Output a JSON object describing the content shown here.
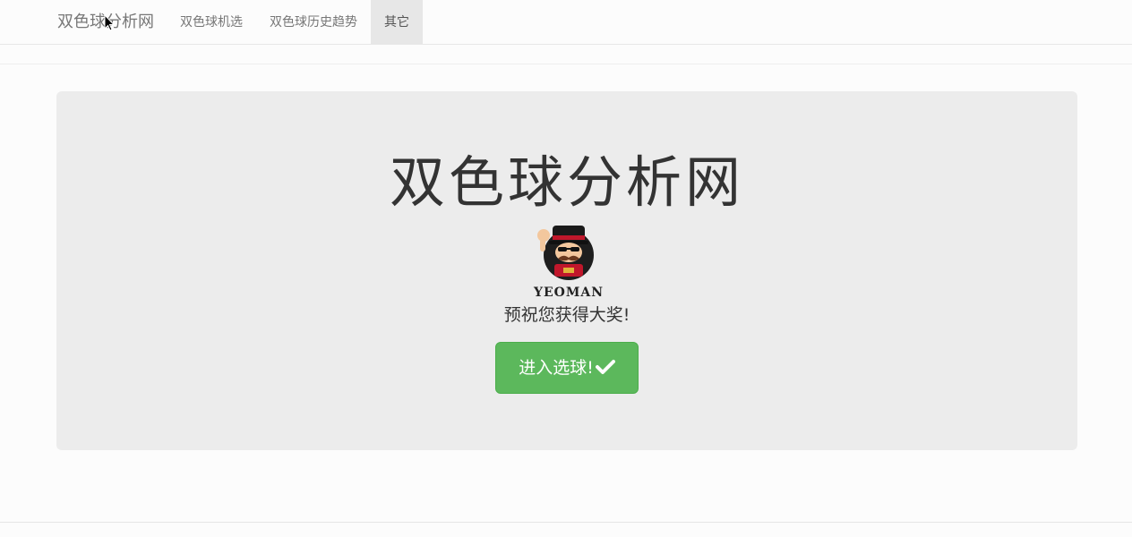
{
  "navbar": {
    "brand": "双色球分析网",
    "items": [
      {
        "label": "双色球机选",
        "active": false
      },
      {
        "label": "双色球历史趋势",
        "active": false
      },
      {
        "label": "其它",
        "active": true
      }
    ]
  },
  "hero": {
    "title": "双色球分析网",
    "logo_text": "YEOMAN",
    "subtitle": "预祝您获得大奖!",
    "cta_label": "进入选球!",
    "cta_icon": "check-icon"
  },
  "colors": {
    "cta_bg": "#5cb85c",
    "jumbotron_bg": "#ececec",
    "nav_active_bg": "#e7e7e7"
  }
}
